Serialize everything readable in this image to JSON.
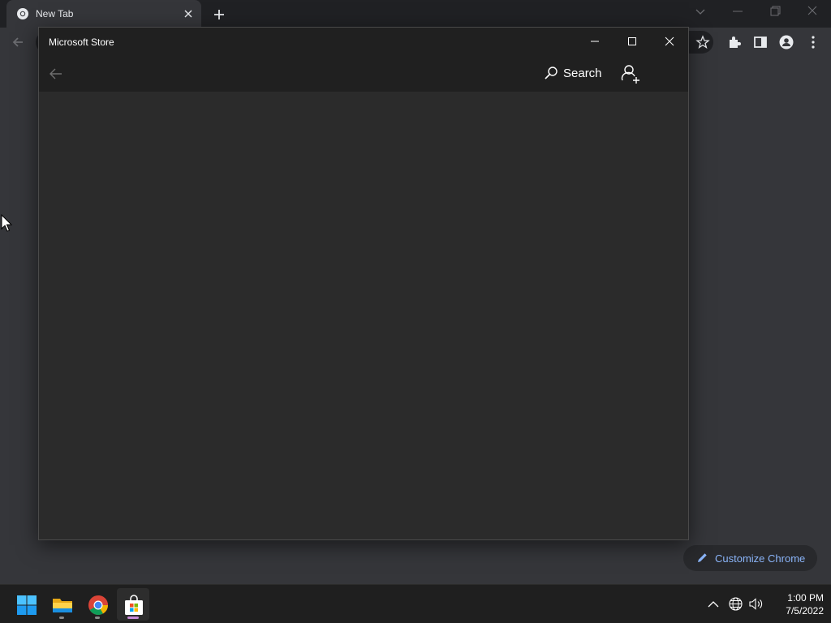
{
  "chrome": {
    "tab_title": "New Tab",
    "customize_label": "Customize Chrome",
    "accent_color": "#8ab4f8"
  },
  "store": {
    "title": "Microsoft Store",
    "search_label": "Search"
  },
  "taskbar": {
    "apps": [
      "windows-start",
      "file-explorer",
      "google-chrome",
      "microsoft-store"
    ],
    "time": "1:00 PM",
    "date": "7/5/2022"
  }
}
